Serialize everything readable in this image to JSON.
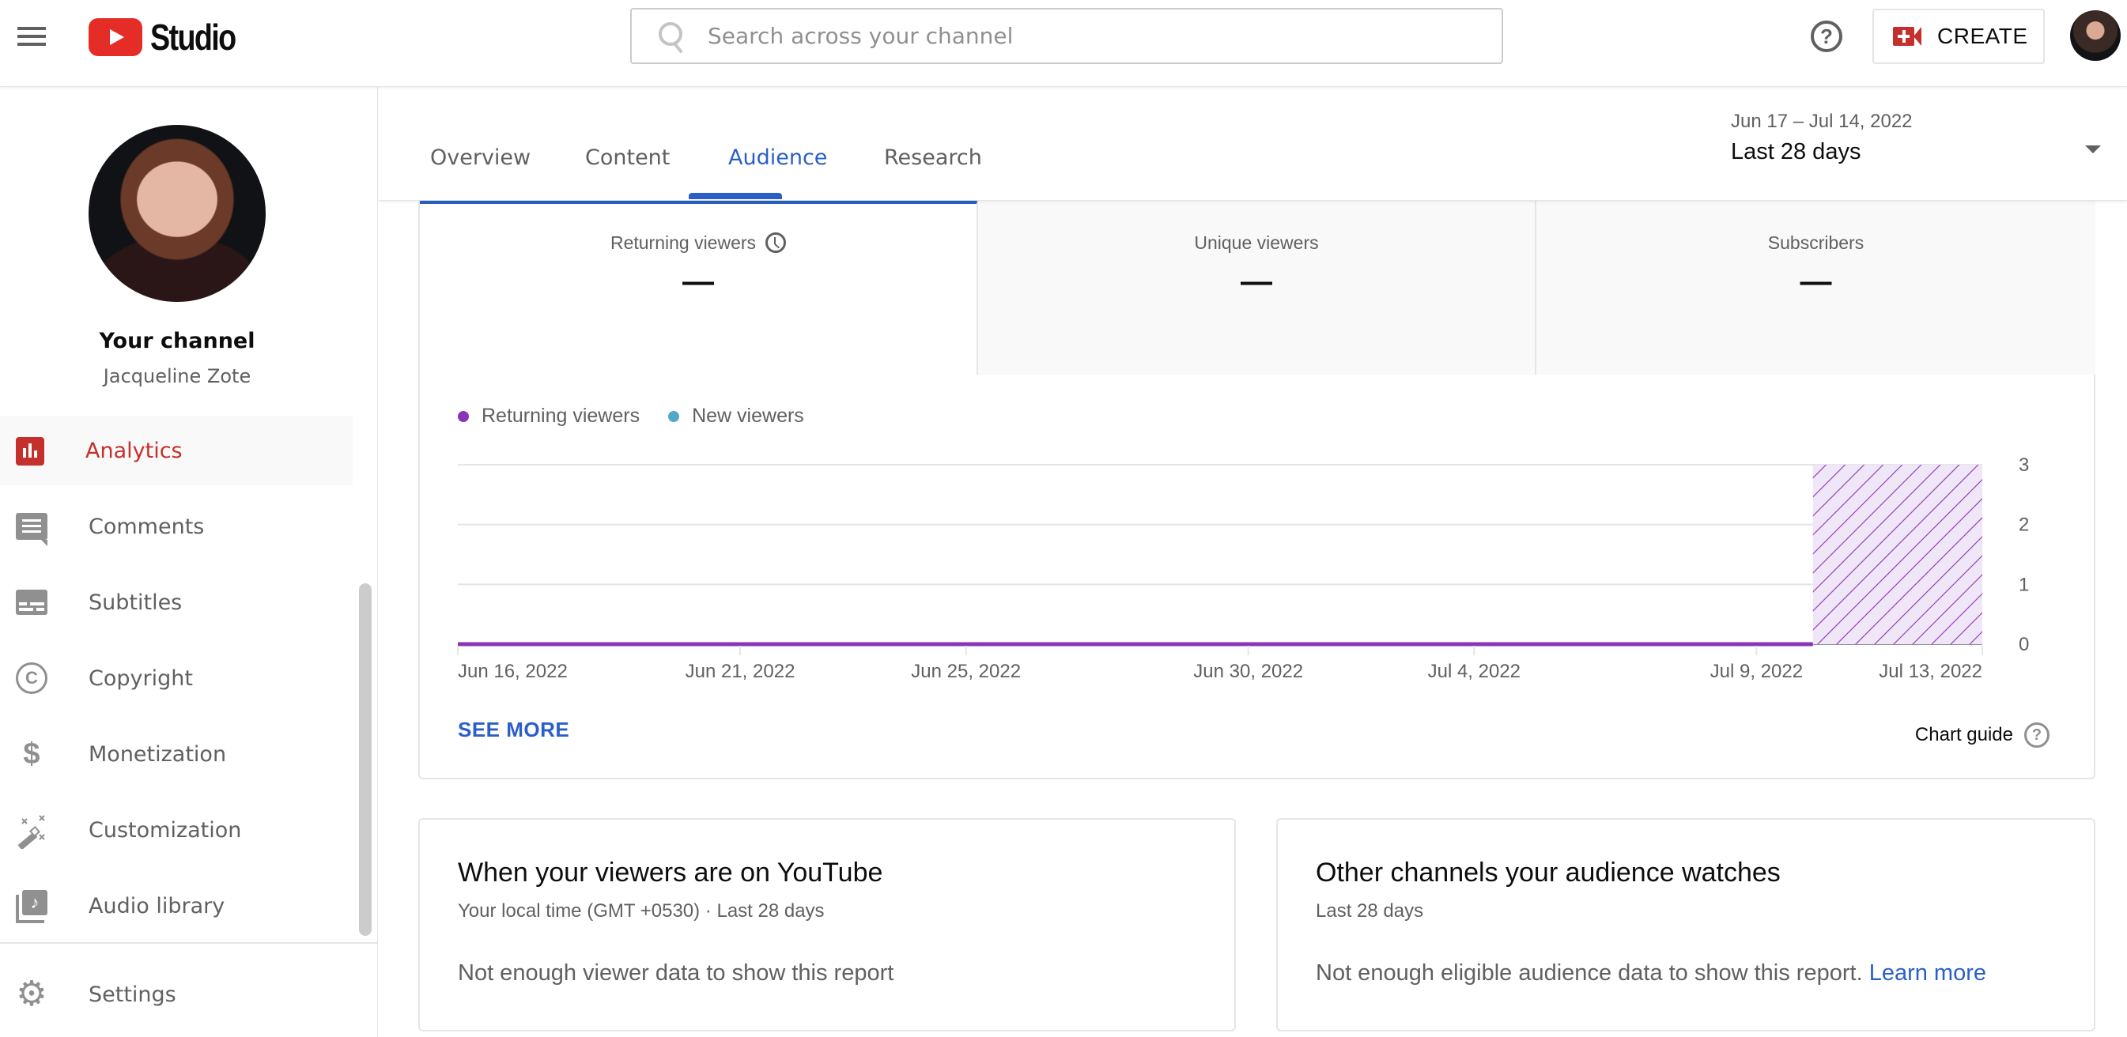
{
  "header": {
    "app_name": "Studio",
    "search_placeholder": "Search across your channel",
    "search_value": "",
    "create_label": "CREATE"
  },
  "sidebar": {
    "channel_title": "Your channel",
    "channel_name": "Jacqueline Zote",
    "items": [
      {
        "label": "Analytics",
        "icon": "analytics-icon",
        "active": true
      },
      {
        "label": "Comments",
        "icon": "comments-icon",
        "active": false
      },
      {
        "label": "Subtitles",
        "icon": "subtitles-icon",
        "active": false
      },
      {
        "label": "Copyright",
        "icon": "copyright-icon",
        "active": false
      },
      {
        "label": "Monetization",
        "icon": "dollar-icon",
        "active": false
      },
      {
        "label": "Customization",
        "icon": "magic-wand-icon",
        "active": false
      },
      {
        "label": "Audio library",
        "icon": "audio-library-icon",
        "active": false
      }
    ],
    "settings_label": "Settings"
  },
  "tabs": [
    {
      "label": "Overview",
      "active": false
    },
    {
      "label": "Content",
      "active": false
    },
    {
      "label": "Audience",
      "active": true
    },
    {
      "label": "Research",
      "active": false
    }
  ],
  "date_range": {
    "range": "Jun 17 – Jul 14, 2022",
    "period": "Last 28 days"
  },
  "metrics": [
    {
      "label": "Returning viewers",
      "value": "—",
      "active": true
    },
    {
      "label": "Unique viewers",
      "value": "—",
      "active": false
    },
    {
      "label": "Subscribers",
      "value": "—",
      "active": false
    }
  ],
  "colors": {
    "accent_blue": "#2b5fc8",
    "brand_red": "#c4302b",
    "returning_viewers": "#8a35b8",
    "new_viewers": "#54a6cc"
  },
  "chart_data": {
    "type": "line",
    "title": "",
    "xlabel": "",
    "ylabel": "",
    "legend": [
      "Returning viewers",
      "New viewers"
    ],
    "legend_position": "top-left",
    "x_tick_labels": [
      "Jun 16, 2022",
      "Jun 21, 2022",
      "Jun 25, 2022",
      "Jun 30, 2022",
      "Jul 4, 2022",
      "Jul 9, 2022",
      "Jul 13, 2022"
    ],
    "x_range": [
      "Jun 16, 2022",
      "Jul 13, 2022"
    ],
    "y_ticks": [
      0,
      1,
      2,
      3
    ],
    "ylim": [
      0,
      3
    ],
    "grid": true,
    "series": [
      {
        "name": "Returning viewers",
        "x_start": "Jun 16, 2022",
        "x_end": "Jul 10, 2022",
        "values": "all 0"
      },
      {
        "name": "New viewers",
        "values": "all 0"
      }
    ],
    "incomplete_period": {
      "from": "Jul 10, 2022",
      "to": "Jul 13, 2022",
      "style": "hatched"
    }
  },
  "chart_labels": {
    "see_more": "SEE MORE",
    "chart_guide": "Chart guide"
  },
  "cards": [
    {
      "title": "When your viewers are on YouTube",
      "subtitle": "Your local time (GMT +0530) · Last 28 days",
      "message": "Not enough viewer data to show this report",
      "link": ""
    },
    {
      "title": "Other channels your audience watches",
      "subtitle": "Last 28 days",
      "message": "Not enough eligible audience data to show this report.",
      "link": "Learn more"
    }
  ]
}
